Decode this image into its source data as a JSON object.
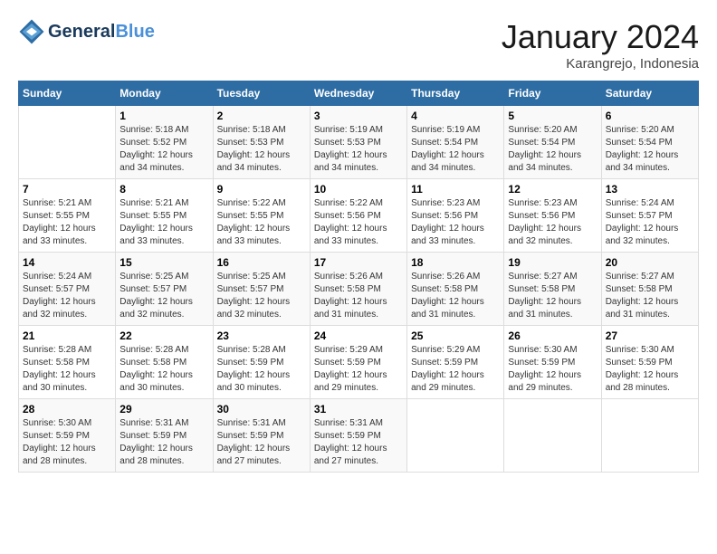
{
  "header": {
    "logo_line1": "General",
    "logo_line2": "Blue",
    "month": "January 2024",
    "location": "Karangrejo, Indonesia"
  },
  "weekdays": [
    "Sunday",
    "Monday",
    "Tuesday",
    "Wednesday",
    "Thursday",
    "Friday",
    "Saturday"
  ],
  "weeks": [
    [
      {
        "day": "",
        "info": ""
      },
      {
        "day": "1",
        "info": "Sunrise: 5:18 AM\nSunset: 5:52 PM\nDaylight: 12 hours\nand 34 minutes."
      },
      {
        "day": "2",
        "info": "Sunrise: 5:18 AM\nSunset: 5:53 PM\nDaylight: 12 hours\nand 34 minutes."
      },
      {
        "day": "3",
        "info": "Sunrise: 5:19 AM\nSunset: 5:53 PM\nDaylight: 12 hours\nand 34 minutes."
      },
      {
        "day": "4",
        "info": "Sunrise: 5:19 AM\nSunset: 5:54 PM\nDaylight: 12 hours\nand 34 minutes."
      },
      {
        "day": "5",
        "info": "Sunrise: 5:20 AM\nSunset: 5:54 PM\nDaylight: 12 hours\nand 34 minutes."
      },
      {
        "day": "6",
        "info": "Sunrise: 5:20 AM\nSunset: 5:54 PM\nDaylight: 12 hours\nand 34 minutes."
      }
    ],
    [
      {
        "day": "7",
        "info": "Sunrise: 5:21 AM\nSunset: 5:55 PM\nDaylight: 12 hours\nand 33 minutes."
      },
      {
        "day": "8",
        "info": "Sunrise: 5:21 AM\nSunset: 5:55 PM\nDaylight: 12 hours\nand 33 minutes."
      },
      {
        "day": "9",
        "info": "Sunrise: 5:22 AM\nSunset: 5:55 PM\nDaylight: 12 hours\nand 33 minutes."
      },
      {
        "day": "10",
        "info": "Sunrise: 5:22 AM\nSunset: 5:56 PM\nDaylight: 12 hours\nand 33 minutes."
      },
      {
        "day": "11",
        "info": "Sunrise: 5:23 AM\nSunset: 5:56 PM\nDaylight: 12 hours\nand 33 minutes."
      },
      {
        "day": "12",
        "info": "Sunrise: 5:23 AM\nSunset: 5:56 PM\nDaylight: 12 hours\nand 32 minutes."
      },
      {
        "day": "13",
        "info": "Sunrise: 5:24 AM\nSunset: 5:57 PM\nDaylight: 12 hours\nand 32 minutes."
      }
    ],
    [
      {
        "day": "14",
        "info": "Sunrise: 5:24 AM\nSunset: 5:57 PM\nDaylight: 12 hours\nand 32 minutes."
      },
      {
        "day": "15",
        "info": "Sunrise: 5:25 AM\nSunset: 5:57 PM\nDaylight: 12 hours\nand 32 minutes."
      },
      {
        "day": "16",
        "info": "Sunrise: 5:25 AM\nSunset: 5:57 PM\nDaylight: 12 hours\nand 32 minutes."
      },
      {
        "day": "17",
        "info": "Sunrise: 5:26 AM\nSunset: 5:58 PM\nDaylight: 12 hours\nand 31 minutes."
      },
      {
        "day": "18",
        "info": "Sunrise: 5:26 AM\nSunset: 5:58 PM\nDaylight: 12 hours\nand 31 minutes."
      },
      {
        "day": "19",
        "info": "Sunrise: 5:27 AM\nSunset: 5:58 PM\nDaylight: 12 hours\nand 31 minutes."
      },
      {
        "day": "20",
        "info": "Sunrise: 5:27 AM\nSunset: 5:58 PM\nDaylight: 12 hours\nand 31 minutes."
      }
    ],
    [
      {
        "day": "21",
        "info": "Sunrise: 5:28 AM\nSunset: 5:58 PM\nDaylight: 12 hours\nand 30 minutes."
      },
      {
        "day": "22",
        "info": "Sunrise: 5:28 AM\nSunset: 5:58 PM\nDaylight: 12 hours\nand 30 minutes."
      },
      {
        "day": "23",
        "info": "Sunrise: 5:28 AM\nSunset: 5:59 PM\nDaylight: 12 hours\nand 30 minutes."
      },
      {
        "day": "24",
        "info": "Sunrise: 5:29 AM\nSunset: 5:59 PM\nDaylight: 12 hours\nand 29 minutes."
      },
      {
        "day": "25",
        "info": "Sunrise: 5:29 AM\nSunset: 5:59 PM\nDaylight: 12 hours\nand 29 minutes."
      },
      {
        "day": "26",
        "info": "Sunrise: 5:30 AM\nSunset: 5:59 PM\nDaylight: 12 hours\nand 29 minutes."
      },
      {
        "day": "27",
        "info": "Sunrise: 5:30 AM\nSunset: 5:59 PM\nDaylight: 12 hours\nand 28 minutes."
      }
    ],
    [
      {
        "day": "28",
        "info": "Sunrise: 5:30 AM\nSunset: 5:59 PM\nDaylight: 12 hours\nand 28 minutes."
      },
      {
        "day": "29",
        "info": "Sunrise: 5:31 AM\nSunset: 5:59 PM\nDaylight: 12 hours\nand 28 minutes."
      },
      {
        "day": "30",
        "info": "Sunrise: 5:31 AM\nSunset: 5:59 PM\nDaylight: 12 hours\nand 27 minutes."
      },
      {
        "day": "31",
        "info": "Sunrise: 5:31 AM\nSunset: 5:59 PM\nDaylight: 12 hours\nand 27 minutes."
      },
      {
        "day": "",
        "info": ""
      },
      {
        "day": "",
        "info": ""
      },
      {
        "day": "",
        "info": ""
      }
    ]
  ]
}
